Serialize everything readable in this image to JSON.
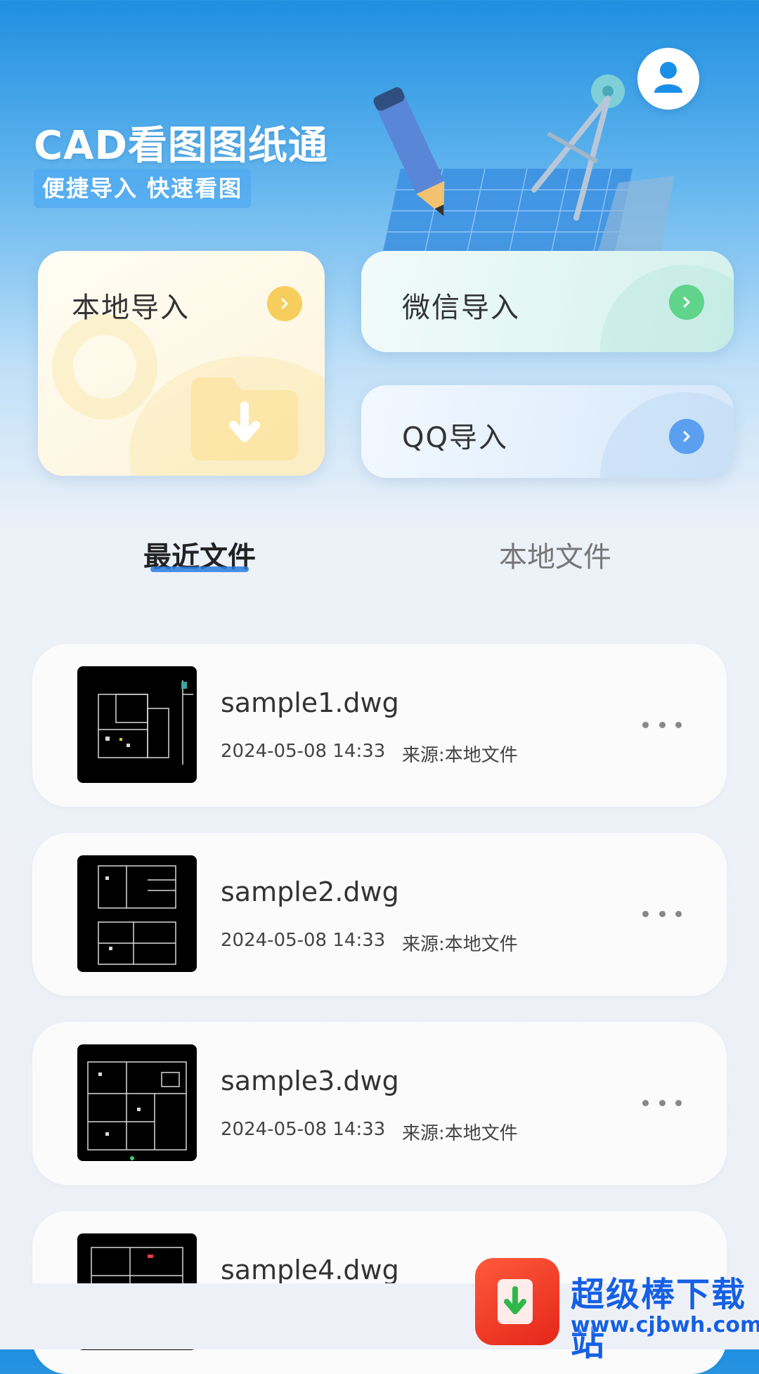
{
  "header": {
    "app_title": "CAD看图图纸通",
    "slogan": "便捷导入 快速看图",
    "avatar_icon": "user-icon"
  },
  "import_cards": {
    "local": {
      "label": "本地导入",
      "accent": "#f7cd5e",
      "icon": "folder-download-icon"
    },
    "wechat": {
      "label": "微信导入",
      "accent": "#5fd48a"
    },
    "qq": {
      "label": "QQ导入",
      "accent": "#5b9ff0"
    }
  },
  "tabs": [
    {
      "label": "最近文件",
      "active": true
    },
    {
      "label": "本地文件",
      "active": false
    }
  ],
  "files": [
    {
      "name": "sample1.dwg",
      "time": "2024-05-08 14:33",
      "source": "来源:本地文件"
    },
    {
      "name": "sample2.dwg",
      "time": "2024-05-08 14:33",
      "source": "来源:本地文件"
    },
    {
      "name": "sample3.dwg",
      "time": "2024-05-08 14:33",
      "source": "来源:本地文件"
    },
    {
      "name": "sample4.dwg",
      "time": "",
      "source": ""
    }
  ],
  "watermark": {
    "title": "超级棒下载站",
    "url": "www.cjbwh.com"
  },
  "colors": {
    "primary_blue": "#2a7de1",
    "header_gradient_top": "#1f8fe0",
    "background": "#eef0f7"
  }
}
